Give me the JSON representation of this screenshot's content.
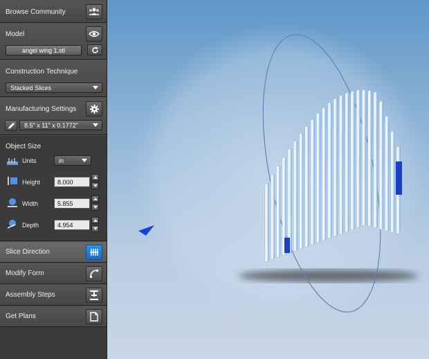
{
  "panel": {
    "browse_community": "Browse Community",
    "model": {
      "title": "Model",
      "file": "angel wing 1.stl"
    },
    "construction": {
      "title": "Construction Technique",
      "value": "Stacked Slices"
    },
    "manufacturing": {
      "title": "Manufacturing Settings",
      "value": "8.5\" x 11\" x 0.1772\""
    },
    "object_size": {
      "title": "Object Size",
      "units_label": "Units",
      "units_value": "in",
      "height_label": "Height",
      "height_value": "8.000",
      "width_label": "Width",
      "width_value": "5.855",
      "depth_label": "Depth",
      "depth_value": "4.954"
    },
    "slice_direction": "Slice Direction",
    "modify_form": "Modify Form",
    "assembly_steps": "Assembly Steps",
    "get_plans": "Get Plans"
  },
  "colors": {
    "accent": "#2a7fd6",
    "viewport_top": "#5e97c9",
    "viewport_bottom": "#c8d6e5",
    "slice_blue": "#1a3fc4"
  },
  "icons": {
    "browse": "people-icon",
    "model": "eye-icon",
    "refresh": "refresh-icon",
    "settings": "gear-icon",
    "edit": "pencil-icon",
    "slice": "slice-direction-icon",
    "modify": "modify-form-icon",
    "assembly": "assembly-steps-icon",
    "plans": "document-icon"
  }
}
